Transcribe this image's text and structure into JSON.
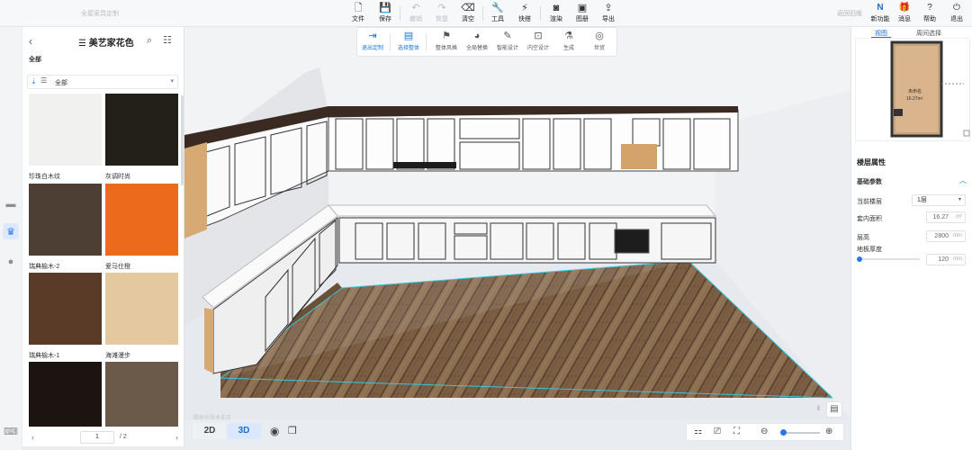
{
  "app": {
    "title": "全屋家具定制"
  },
  "toolbar": {
    "file": "文件",
    "save": "保存",
    "undo": "撤销",
    "redo": "恢复",
    "clear": "清空",
    "tools": "工具",
    "quick": "快搭",
    "render": "渲染",
    "drawing": "图册",
    "export": "导出"
  },
  "topright": {
    "back_link": "返回旧版",
    "new_feature": "新功能",
    "message": "消息",
    "help": "帮助",
    "logout": "退出"
  },
  "toolpanel": {
    "exit_custom": "退出定制",
    "select_layout": "选择整体",
    "overall_style": "整体风格",
    "global_replace": "全局替换",
    "smart_design": "智能设计",
    "inner_space": "内空设计",
    "generate": "生成",
    "world": "世贸"
  },
  "material_panel": {
    "title": "美艺家花色",
    "category": "全部",
    "filter_value": "全部",
    "items": [
      {
        "label": "珍珠白木纹",
        "color": "#f1f1f0"
      },
      {
        "label": "灰调时尚",
        "color": "#231f19"
      },
      {
        "label": "瑞典榆木-2",
        "color": "#4d3f34"
      },
      {
        "label": "爱马仕橙",
        "color": "#ec6a1c"
      },
      {
        "label": "瑞典榆木-1",
        "color": "#5a3b27"
      },
      {
        "label": "海滩漫步",
        "color": "#e4c9a0"
      },
      {
        "label": "",
        "color": "#1b1410"
      },
      {
        "label": "",
        "color": "#6b5a4a"
      }
    ],
    "page": "1",
    "total": "/ 2"
  },
  "viewport": {
    "watermark": "酷家乐技术支持"
  },
  "bottom": {
    "view_2d": "2D",
    "view_3d": "3D"
  },
  "right_panel": {
    "tab_view": "视图",
    "tab_select": "周间选择",
    "section_title": "楼层属性",
    "sub_title": "基础参数",
    "floor_label": "当前楼层",
    "floor_value": "1层",
    "area_label": "套内面积",
    "area_value": "16.27",
    "area_unit": "m²",
    "height_label": "层高",
    "height_value": "2800",
    "height_unit": "mm",
    "thickness_label": "地板厚度",
    "thickness_value": "120",
    "thickness_unit": "mm",
    "minimap_label": "未命名",
    "minimap_area": "16.27m²"
  }
}
